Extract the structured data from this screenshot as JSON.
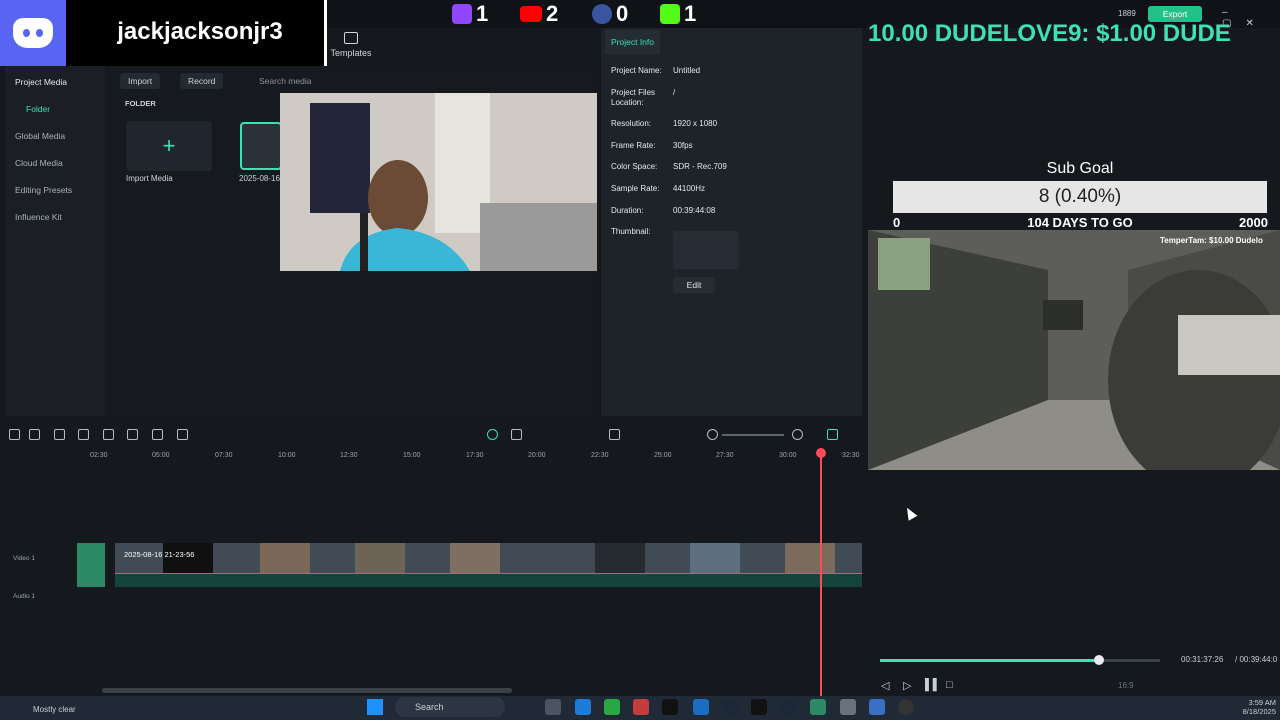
{
  "stream": {
    "username": "jackjacksonjr3",
    "twitch_count": "1",
    "youtube_count": "2",
    "other_count": "0",
    "kick_count": "1",
    "ticker": "10.00   DUDELOVE9: $1.00   DUDE",
    "goal_title": "Sub Goal",
    "goal_value": "8 (0.40%)",
    "goal_min": "0",
    "goal_days": "104 DAYS TO GO",
    "goal_max": "2000",
    "game_ticker": "TemperTam: $10.00  Dudelo"
  },
  "app": {
    "templates_label": "Templates",
    "coins": "1889",
    "export_label": "Export",
    "colors": {
      "accent": "#3ee0b4",
      "playhead": "#ff4a5a",
      "export": "#23c08a"
    }
  },
  "sidebar": {
    "items": [
      {
        "label": "Project Media",
        "type": "header"
      },
      {
        "label": "Folder",
        "type": "active"
      },
      {
        "label": "Global Media",
        "type": "header"
      },
      {
        "label": "Cloud Media",
        "type": "normal"
      },
      {
        "label": "Editing Presets",
        "type": "header"
      },
      {
        "label": "Influence Kit",
        "type": "header"
      }
    ]
  },
  "media": {
    "import_label": "Import",
    "record_label": "Record",
    "search_placeholder": "Search media",
    "folder_label": "FOLDER",
    "import_media_label": "Import Media",
    "clip_label": "2025-08-16"
  },
  "info": {
    "tab_label": "Project Info",
    "rows": [
      {
        "k": "Project Name:",
        "v": "Untitled"
      },
      {
        "k": "Project Files Location:",
        "v": "/"
      },
      {
        "k": "Resolution:",
        "v": "1920 x 1080"
      },
      {
        "k": "Frame Rate:",
        "v": "30fps"
      },
      {
        "k": "Color Space:",
        "v": "SDR - Rec.709"
      },
      {
        "k": "Sample Rate:",
        "v": "44100Hz"
      },
      {
        "k": "Duration:",
        "v": "00:39:44:08"
      },
      {
        "k": "Thumbnail:",
        "v": ""
      }
    ],
    "edit_label": "Edit"
  },
  "timeline": {
    "ticks": [
      "02:30",
      "05:00",
      "07:30",
      "10:00",
      "12:30",
      "15:00",
      "17:30",
      "20:00",
      "22:30",
      "25:00",
      "27:30",
      "30:00",
      "32:30"
    ],
    "video_track": "Video 1",
    "audio_track": "Audio 1",
    "clip_name": "2025-08-16 21-23-56"
  },
  "player": {
    "current_time": "00:31:37:26",
    "total_time": "/ 00:39:44:0",
    "progress": 0.78,
    "ratio": "16:9"
  },
  "taskbar": {
    "weather": "Mostly clear",
    "search_label": "Search",
    "time": "3:59 AM",
    "date": "8/18/2025"
  }
}
